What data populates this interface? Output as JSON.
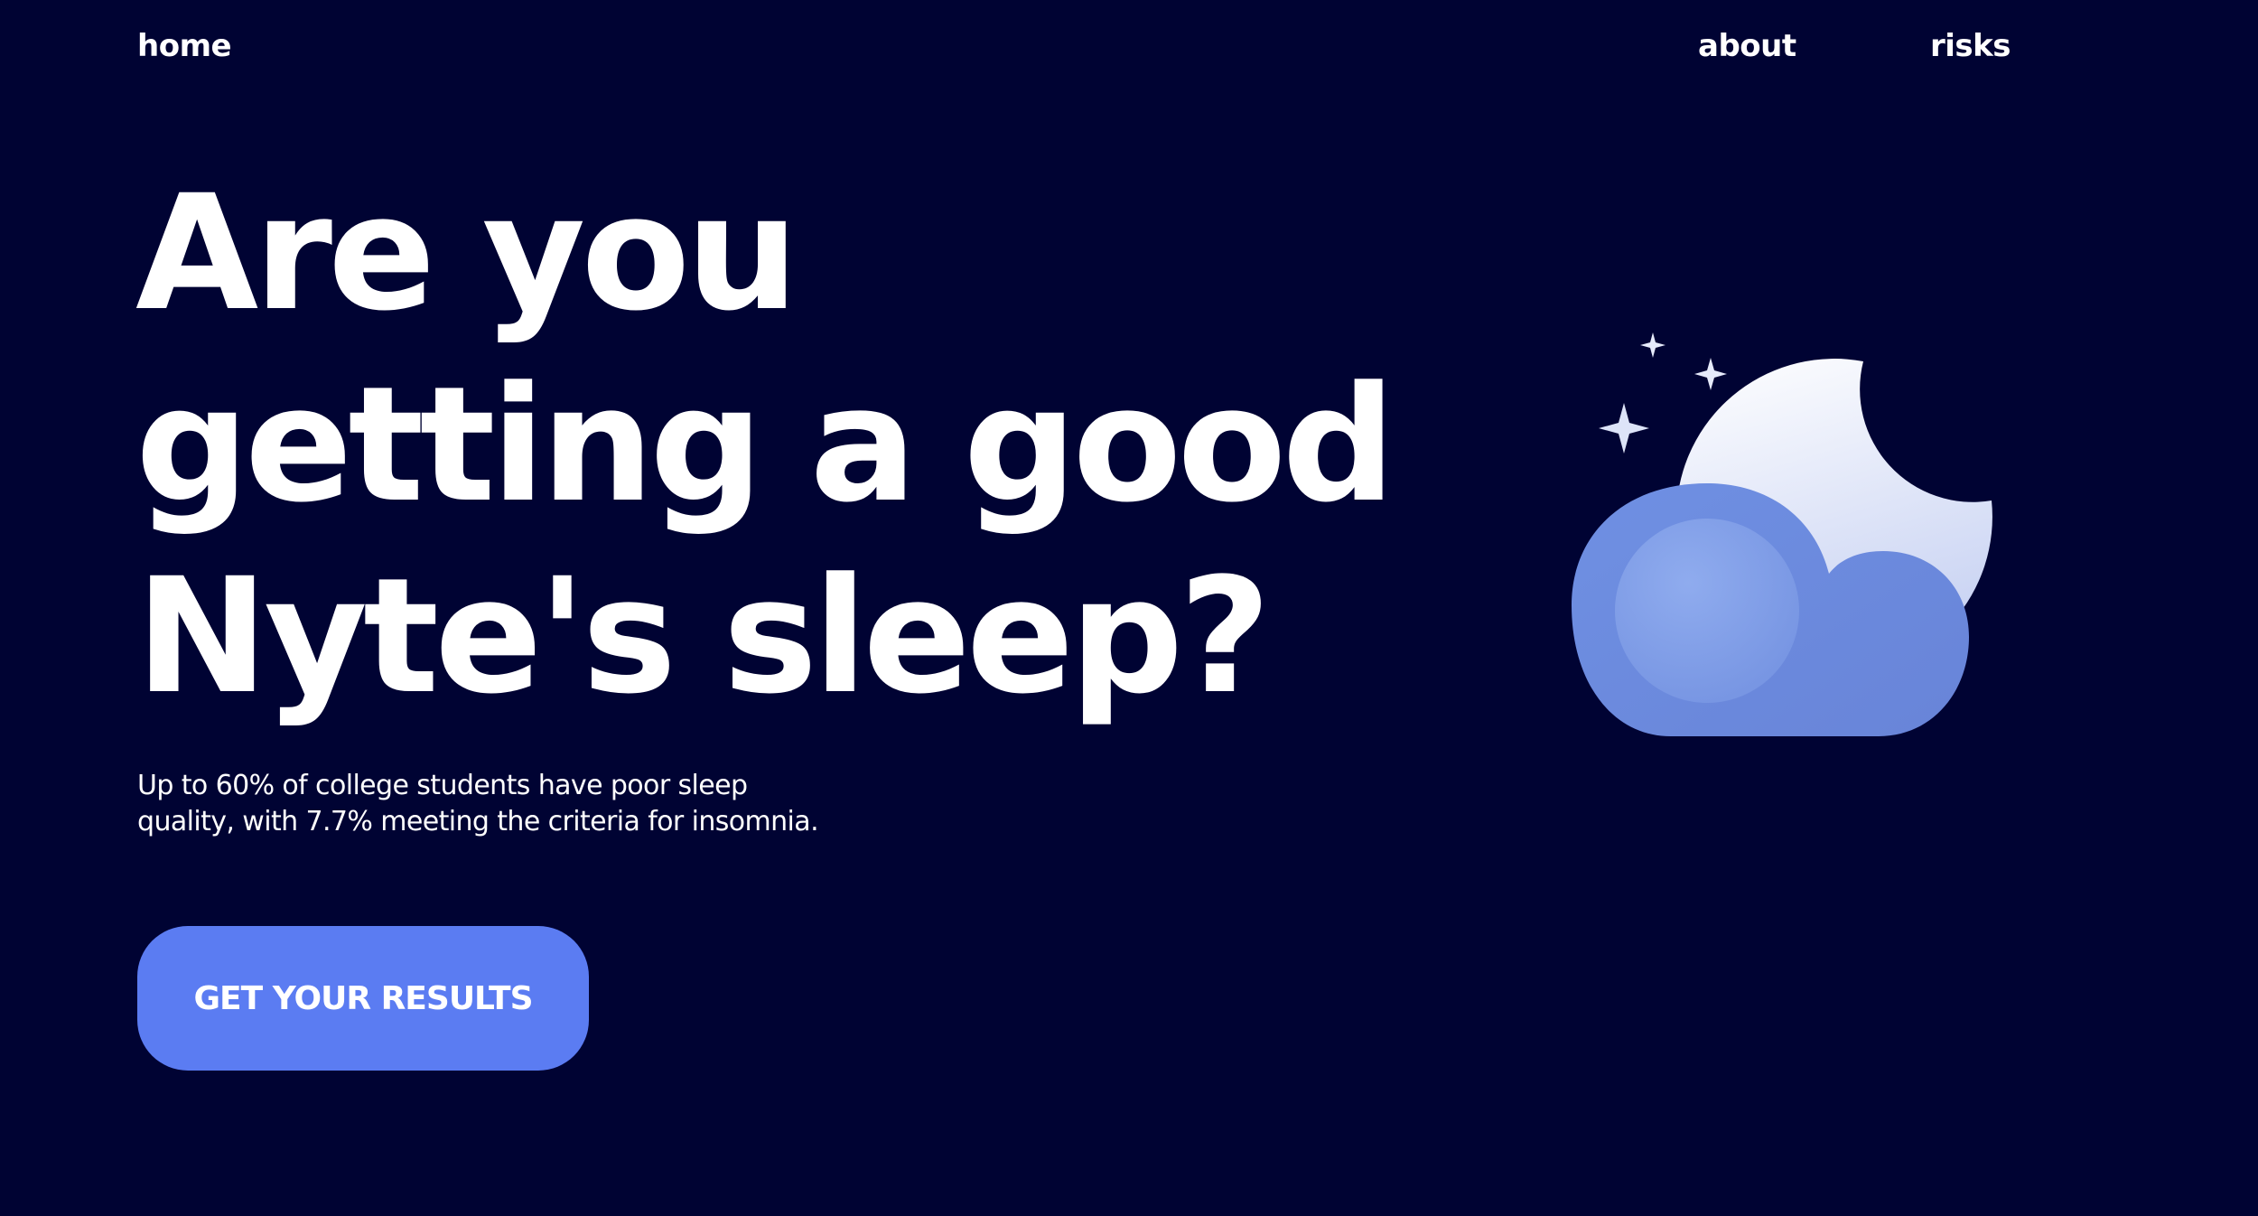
{
  "nav": {
    "home": "home",
    "about": "about",
    "risks": "risks"
  },
  "hero": {
    "headline_line1": "Are you",
    "headline_line2": "getting a good",
    "headline_line3": "Nyte's sleep?",
    "subtitle": "Up to 60% of college students have poor sleep quality, with 7.7% meeting the criteria for insomnia.",
    "cta_label": "GET YOUR RESULTS"
  },
  "colors": {
    "background": "#000333",
    "accent": "#5b7cf2",
    "text": "#ffffff",
    "cloud": "#6b8de0",
    "moon": "#dfe5f7"
  },
  "illustration": {
    "icon": "moon-cloud-stars-icon"
  }
}
